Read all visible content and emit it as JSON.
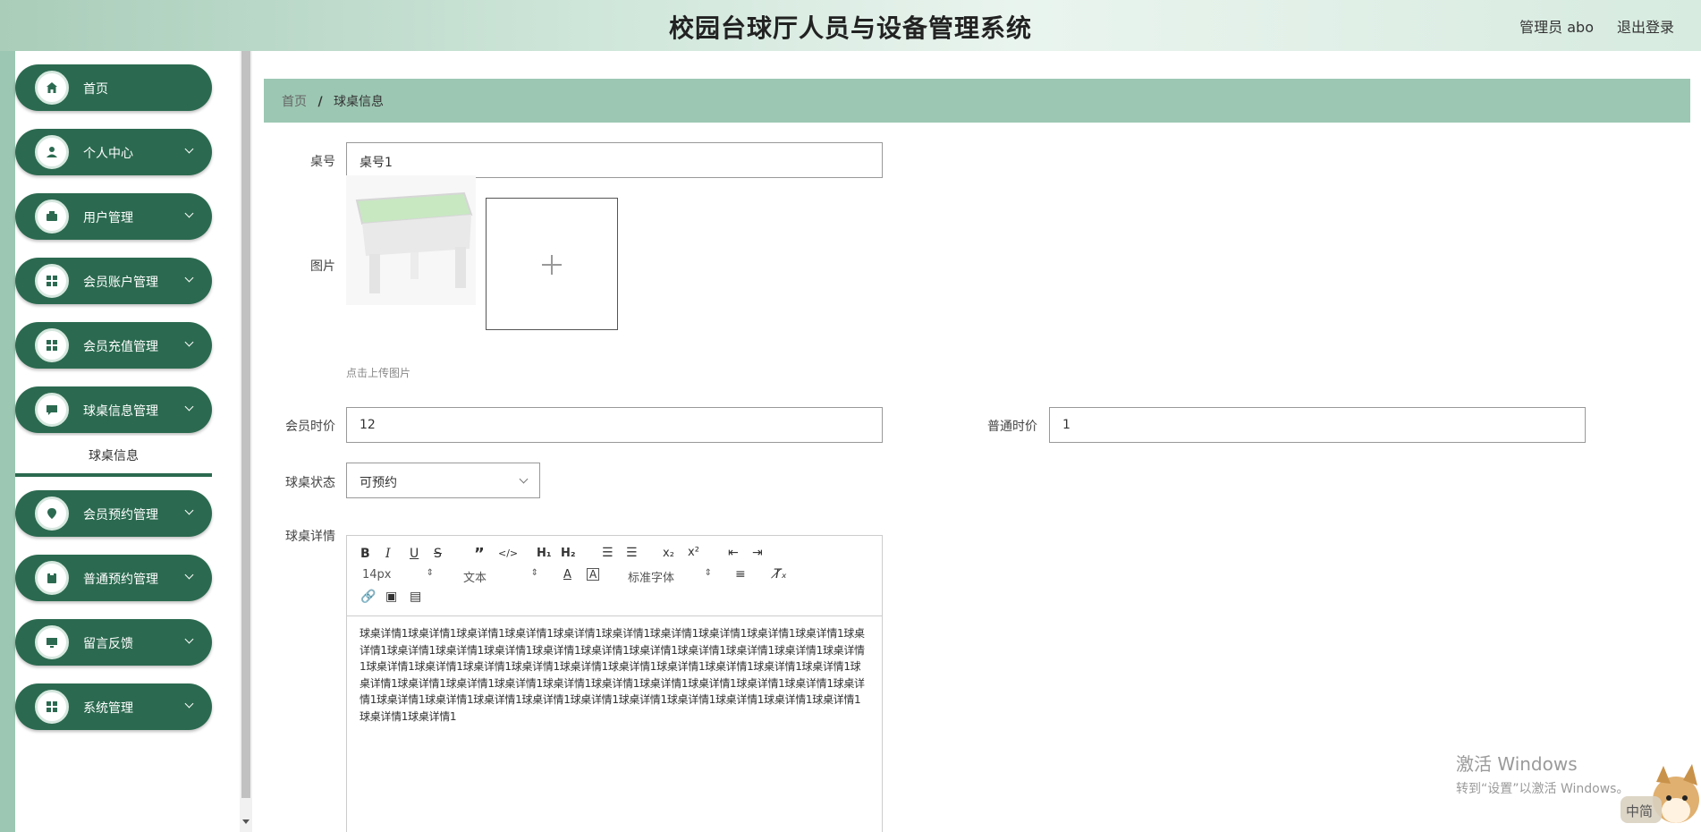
{
  "header": {
    "title": "校园台球厅人员与设备管理系统",
    "admin": "管理员 abo",
    "logout": "退出登录"
  },
  "sidebar": {
    "items": [
      {
        "label": "首页",
        "icon": "home-icon"
      },
      {
        "label": "个人中心",
        "icon": "user-icon"
      },
      {
        "label": "用户管理",
        "icon": "wallet-icon"
      },
      {
        "label": "会员账户管理",
        "icon": "grid-icon"
      },
      {
        "label": "会员充值管理",
        "icon": "grid-icon"
      },
      {
        "label": "球桌信息管理",
        "icon": "message-icon"
      },
      {
        "label": "会员预约管理",
        "icon": "location-icon"
      },
      {
        "label": "普通预约管理",
        "icon": "clipboard-icon"
      },
      {
        "label": "留言反馈",
        "icon": "monitor-icon"
      },
      {
        "label": "系统管理",
        "icon": "grid-icon"
      }
    ],
    "submenu": "球桌信息"
  },
  "breadcrumb": {
    "home": "首页",
    "separator": "/",
    "current": "球桌信息"
  },
  "form": {
    "table_no_label": "桌号",
    "table_no_value": "桌号1",
    "image_label": "图片",
    "upload_hint": "点击上传图片",
    "member_price_label": "会员时价",
    "member_price_value": "12",
    "normal_price_label": "普通时价",
    "normal_price_value": "1",
    "status_label": "球桌状态",
    "status_value": "可预约",
    "detail_label": "球桌详情"
  },
  "editor": {
    "font_size": "14px",
    "format": "文本",
    "font_family": "标准字体",
    "content": "球桌详情1球桌详情1球桌详情1球桌详情1球桌详情1球桌详情1球桌详情1球桌详情1球桌详情1球桌详情1球桌详情1球桌详情1球桌详情1球桌详情1球桌详情1球桌详情1球桌详情1球桌详情1球桌详情1球桌详情1球桌详情1球桌详情1球桌详情1球桌详情1球桌详情1球桌详情1球桌详情1球桌详情1球桌详情1球桌详情1球桌详情1球桌详情1球桌详情1球桌详情1球桌详情1球桌详情1球桌详情1球桌详情1球桌详情1球桌详情1球桌详情1球桌详情1球桌详情1球桌详情1球桌详情1球桌详情1球桌详情1球桌详情1球桌详情1球桌详情1球桌详情1球桌详情1球桌详情1球桌详情1"
  },
  "watermark": {
    "line1": "激活 Windows",
    "line2": "转到“设置”以激活 Windows。"
  },
  "ime": "中简",
  "colors": {
    "primary": "#2b6a50",
    "light": "#9cc7b3"
  }
}
